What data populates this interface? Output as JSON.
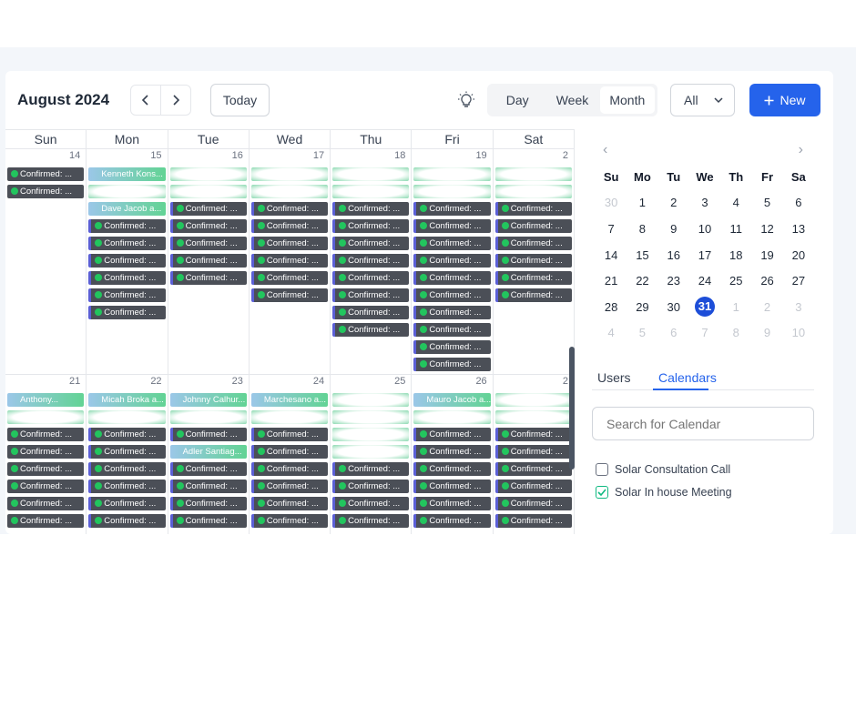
{
  "header": {
    "title": "August 2024",
    "prev_glyph": "‹",
    "next_glyph": "›",
    "today_label": "Today",
    "views": [
      "Day",
      "Week",
      "Month"
    ],
    "active_view": "Month",
    "filter_value": "All",
    "new_label": "New",
    "accent_color": "#2563eb"
  },
  "calendar": {
    "weekdays": [
      "Sun",
      "Mon",
      "Tue",
      "Wed",
      "Thu",
      "Fri",
      "Sat"
    ],
    "event_label": "Confirmed: ...",
    "weeks": [
      {
        "days": [
          {
            "num": "14",
            "events": [
              {
                "text": "Confirmed: ...",
                "style": "dark"
              },
              {
                "text": "Confirmed: ...",
                "style": "dark"
              }
            ]
          },
          {
            "num": "15",
            "events": [
              {
                "text": "Kenneth Kons...",
                "style": "light"
              },
              {
                "text": "",
                "style": "blur"
              },
              {
                "text": "Dave Jacob a...",
                "style": "light"
              },
              {
                "text": "Confirmed: ...",
                "style": "dark"
              },
              {
                "text": "Confirmed: ...",
                "style": "dark"
              },
              {
                "text": "Confirmed: ...",
                "style": "dark"
              },
              {
                "text": "Confirmed: ...",
                "style": "dark"
              },
              {
                "text": "Confirmed: ...",
                "style": "dark"
              },
              {
                "text": "Confirmed: ...",
                "style": "dark"
              }
            ]
          },
          {
            "num": "16",
            "events": [
              {
                "text": "",
                "style": "blur"
              },
              {
                "text": "",
                "style": "blur"
              },
              {
                "text": "Confirmed: ...",
                "style": "dark"
              },
              {
                "text": "Confirmed: ...",
                "style": "dark"
              },
              {
                "text": "Confirmed: ...",
                "style": "dark"
              },
              {
                "text": "Confirmed: ...",
                "style": "dark"
              },
              {
                "text": "Confirmed: ...",
                "style": "dark"
              }
            ]
          },
          {
            "num": "17",
            "events": [
              {
                "text": "",
                "style": "blur"
              },
              {
                "text": "",
                "style": "blur"
              },
              {
                "text": "Confirmed: ...",
                "style": "dark"
              },
              {
                "text": "Confirmed: ...",
                "style": "dark"
              },
              {
                "text": "Confirmed: ...",
                "style": "dark"
              },
              {
                "text": "Confirmed: ...",
                "style": "dark"
              },
              {
                "text": "Confirmed: ...",
                "style": "dark"
              },
              {
                "text": "Confirmed: ...",
                "style": "dark"
              }
            ]
          },
          {
            "num": "18",
            "events": [
              {
                "text": "",
                "style": "blur"
              },
              {
                "text": "",
                "style": "blur"
              },
              {
                "text": "Confirmed: ...",
                "style": "dark"
              },
              {
                "text": "Confirmed: ...",
                "style": "dark"
              },
              {
                "text": "Confirmed: ...",
                "style": "dark"
              },
              {
                "text": "Confirmed: ...",
                "style": "dark"
              },
              {
                "text": "Confirmed: ...",
                "style": "dark"
              },
              {
                "text": "Confirmed: ...",
                "style": "dark"
              },
              {
                "text": "Confirmed: ...",
                "style": "dark"
              },
              {
                "text": "Confirmed: ...",
                "style": "dark"
              }
            ]
          },
          {
            "num": "19",
            "events": [
              {
                "text": "",
                "style": "blur"
              },
              {
                "text": "",
                "style": "blur"
              },
              {
                "text": "Confirmed: ...",
                "style": "dark"
              },
              {
                "text": "Confirmed: ...",
                "style": "dark"
              },
              {
                "text": "Confirmed: ...",
                "style": "dark"
              },
              {
                "text": "Confirmed: ...",
                "style": "dark"
              },
              {
                "text": "Confirmed: ...",
                "style": "dark"
              },
              {
                "text": "Confirmed: ...",
                "style": "dark"
              },
              {
                "text": "Confirmed: ...",
                "style": "dark"
              },
              {
                "text": "Confirmed: ...",
                "style": "dark"
              },
              {
                "text": "Confirmed: ...",
                "style": "dark"
              },
              {
                "text": "Confirmed: ...",
                "style": "dark"
              }
            ]
          },
          {
            "num": "2",
            "events": [
              {
                "text": "",
                "style": "blur"
              },
              {
                "text": "",
                "style": "blur"
              },
              {
                "text": "Confirmed: ...",
                "style": "dark"
              },
              {
                "text": "Confirmed: ...",
                "style": "dark"
              },
              {
                "text": "Confirmed: ...",
                "style": "dark"
              },
              {
                "text": "Confirmed: ...",
                "style": "dark"
              },
              {
                "text": "Confirmed: ...",
                "style": "dark"
              },
              {
                "text": "Confirmed: ...",
                "style": "dark"
              }
            ]
          }
        ]
      },
      {
        "days": [
          {
            "num": "21",
            "events": [
              {
                "text": "Anthony...",
                "style": "light"
              },
              {
                "text": "",
                "style": "blur"
              },
              {
                "text": "Confirmed: ...",
                "style": "dark"
              },
              {
                "text": "Confirmed: ...",
                "style": "dark"
              },
              {
                "text": "Confirmed: ...",
                "style": "dark"
              },
              {
                "text": "Confirmed: ...",
                "style": "dark"
              },
              {
                "text": "Confirmed: ...",
                "style": "dark"
              },
              {
                "text": "Confirmed: ...",
                "style": "dark"
              }
            ]
          },
          {
            "num": "22",
            "events": [
              {
                "text": "Micah Broka a...",
                "style": "light"
              },
              {
                "text": "",
                "style": "blur"
              },
              {
                "text": "Confirmed: ...",
                "style": "dark"
              },
              {
                "text": "Confirmed: ...",
                "style": "dark"
              },
              {
                "text": "Confirmed: ...",
                "style": "dark"
              },
              {
                "text": "Confirmed: ...",
                "style": "dark"
              },
              {
                "text": "Confirmed: ...",
                "style": "dark"
              },
              {
                "text": "Confirmed: ...",
                "style": "dark"
              }
            ]
          },
          {
            "num": "23",
            "events": [
              {
                "text": "Johnny Calhur...",
                "style": "light"
              },
              {
                "text": "",
                "style": "blur"
              },
              {
                "text": "Confirmed: ...",
                "style": "dark"
              },
              {
                "text": "Adler Santiag...",
                "style": "light"
              },
              {
                "text": "Confirmed: ...",
                "style": "dark"
              },
              {
                "text": "Confirmed: ...",
                "style": "dark"
              },
              {
                "text": "Confirmed: ...",
                "style": "dark"
              },
              {
                "text": "Confirmed: ...",
                "style": "dark"
              }
            ]
          },
          {
            "num": "24",
            "events": [
              {
                "text": "Marchesano a...",
                "style": "light"
              },
              {
                "text": "",
                "style": "blur"
              },
              {
                "text": "Confirmed: ...",
                "style": "dark"
              },
              {
                "text": "Confirmed: ...",
                "style": "dark"
              },
              {
                "text": "Confirmed: ...",
                "style": "dark"
              },
              {
                "text": "Confirmed: ...",
                "style": "dark"
              },
              {
                "text": "Confirmed: ...",
                "style": "dark"
              },
              {
                "text": "Confirmed: ...",
                "style": "dark"
              }
            ]
          },
          {
            "num": "25",
            "events": [
              {
                "text": "",
                "style": "blur"
              },
              {
                "text": "",
                "style": "blur"
              },
              {
                "text": "",
                "style": "blur"
              },
              {
                "text": "",
                "style": "blur"
              },
              {
                "text": "Confirmed: ...",
                "style": "dark"
              },
              {
                "text": "Confirmed: ...",
                "style": "dark"
              },
              {
                "text": "Confirmed: ...",
                "style": "dark"
              },
              {
                "text": "Confirmed: ...",
                "style": "dark"
              }
            ]
          },
          {
            "num": "26",
            "events": [
              {
                "text": "Mauro Jacob a...",
                "style": "light"
              },
              {
                "text": "",
                "style": "blur"
              },
              {
                "text": "Confirmed: ...",
                "style": "dark"
              },
              {
                "text": "Confirmed: ...",
                "style": "dark"
              },
              {
                "text": "Confirmed: ...",
                "style": "dark"
              },
              {
                "text": "Confirmed: ...",
                "style": "dark"
              },
              {
                "text": "Confirmed: ...",
                "style": "dark"
              },
              {
                "text": "Confirmed: ...",
                "style": "dark"
              }
            ]
          },
          {
            "num": "2",
            "events": [
              {
                "text": "",
                "style": "blur"
              },
              {
                "text": "",
                "style": "blur"
              },
              {
                "text": "Confirmed: ...",
                "style": "dark"
              },
              {
                "text": "Confirmed: ...",
                "style": "dark"
              },
              {
                "text": "Confirmed: ...",
                "style": "dark"
              },
              {
                "text": "Confirmed: ...",
                "style": "dark"
              },
              {
                "text": "Confirmed: ...",
                "style": "dark"
              },
              {
                "text": "Confirmed: ...",
                "style": "dark"
              }
            ]
          }
        ]
      }
    ]
  },
  "mini_calendar": {
    "prev_glyph": "‹",
    "next_glyph": "›",
    "weekdays": [
      "Su",
      "Mo",
      "Tu",
      "We",
      "Th",
      "Fr",
      "Sa"
    ],
    "weeks": [
      [
        {
          "d": "30",
          "m": true
        },
        {
          "d": "1"
        },
        {
          "d": "2"
        },
        {
          "d": "3"
        },
        {
          "d": "4"
        },
        {
          "d": "5"
        },
        {
          "d": "6"
        }
      ],
      [
        {
          "d": "7"
        },
        {
          "d": "8"
        },
        {
          "d": "9"
        },
        {
          "d": "10"
        },
        {
          "d": "11"
        },
        {
          "d": "12"
        },
        {
          "d": "13"
        }
      ],
      [
        {
          "d": "14"
        },
        {
          "d": "15"
        },
        {
          "d": "16"
        },
        {
          "d": "17"
        },
        {
          "d": "18"
        },
        {
          "d": "19"
        },
        {
          "d": "20"
        }
      ],
      [
        {
          "d": "21"
        },
        {
          "d": "22"
        },
        {
          "d": "23"
        },
        {
          "d": "24"
        },
        {
          "d": "25"
        },
        {
          "d": "26"
        },
        {
          "d": "27"
        }
      ],
      [
        {
          "d": "28"
        },
        {
          "d": "29"
        },
        {
          "d": "30"
        },
        {
          "d": "31",
          "sel": true
        },
        {
          "d": "1",
          "m": true
        },
        {
          "d": "2",
          "m": true
        },
        {
          "d": "3",
          "m": true
        }
      ],
      [
        {
          "d": "4",
          "m": true
        },
        {
          "d": "5",
          "m": true
        },
        {
          "d": "6",
          "m": true
        },
        {
          "d": "7",
          "m": true
        },
        {
          "d": "8",
          "m": true
        },
        {
          "d": "9",
          "m": true
        },
        {
          "d": "10",
          "m": true
        }
      ]
    ]
  },
  "sidebar": {
    "tabs": [
      "Users",
      "Calendars"
    ],
    "active_tab": "Calendars",
    "search_placeholder": "Search for Calendar",
    "calendars": [
      {
        "label": "Solar Consultation Call",
        "checked": false
      },
      {
        "label": "Solar In house Meeting",
        "checked": true
      }
    ]
  }
}
